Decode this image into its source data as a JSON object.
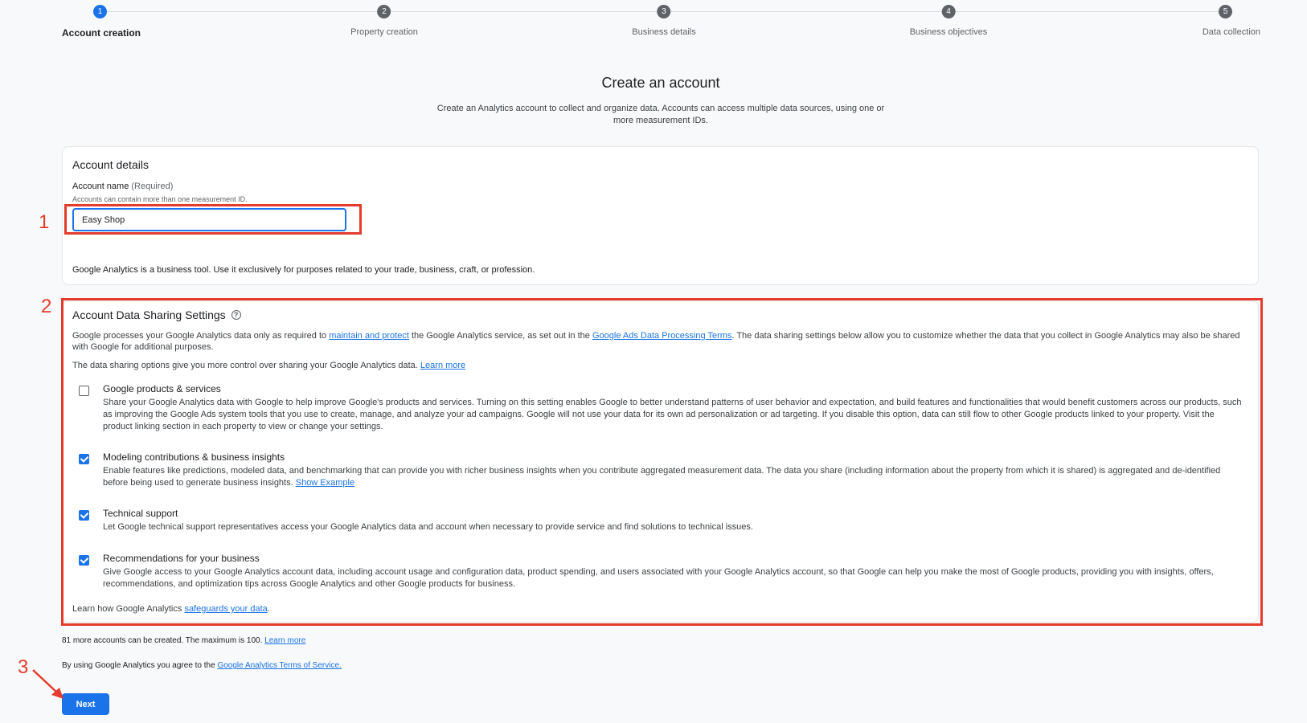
{
  "stepper": {
    "steps": [
      {
        "number": "1",
        "label": "Account creation",
        "active": true
      },
      {
        "number": "2",
        "label": "Property creation",
        "active": false
      },
      {
        "number": "3",
        "label": "Business details",
        "active": false
      },
      {
        "number": "4",
        "label": "Business objectives",
        "active": false
      },
      {
        "number": "5",
        "label": "Data collection",
        "active": false
      }
    ]
  },
  "header": {
    "title": "Create an account",
    "subtitle": "Create an Analytics account to collect and organize data. Accounts can access multiple data sources, using one or more measurement IDs."
  },
  "account_details": {
    "title": "Account details",
    "field_label": "Account name",
    "field_required": "(Required)",
    "field_hint": "Accounts can contain more than one measurement ID.",
    "field_value": "Easy Shop",
    "disclaimer": "Google Analytics is a business tool. Use it exclusively for purposes related to your trade, business, craft, or profession."
  },
  "sharing": {
    "title": "Account Data Sharing Settings",
    "help_icon": "?",
    "intro_1": "Google processes your Google Analytics data only as required to",
    "intro_link_1": "maintain and protect",
    "intro_2": "the Google Analytics service, as set out in the",
    "intro_link_2": "Google Ads Data Processing Terms",
    "intro_3": ". The data sharing settings below allow you to customize whether the data that you collect in Google Analytics may also be shared with Google for additional purposes.",
    "control_text": "The data sharing options give you more control over sharing your Google Analytics data.",
    "control_link": "Learn more",
    "options": [
      {
        "title": "Google products & services",
        "checked": false,
        "description": "Share your Google Analytics data with Google to help improve Google's products and services. Turning on this setting enables Google to better understand patterns of user behavior and expectation, and build features and functionalities that would benefit customers across our products, such as improving the Google Ads system tools that you use to create, manage, and analyze your ad campaigns. Google will not use your data for its own ad personalization or ad targeting. If you disable this option, data can still flow to other Google products linked to your property. Visit the product linking section in each property to view or change your settings."
      },
      {
        "title": "Modeling contributions & business insights",
        "checked": true,
        "description": "Enable features like predictions, modeled data, and benchmarking that can provide you with richer business insights when you contribute aggregated measurement data. The data you share (including information about the property from which it is shared) is aggregated and de-identified before being used to generate business insights.",
        "link": "Show Example"
      },
      {
        "title": "Technical support",
        "checked": true,
        "description": "Let Google technical support representatives access your Google Analytics data and account when necessary to provide service and find solutions to technical issues."
      },
      {
        "title": "Recommendations for your business",
        "checked": true,
        "description": "Give Google access to your Google Analytics account data, including account usage and configuration data, product spending, and users associated with your Google Analytics account, so that Google can help you make the most of Google products, providing you with insights, offers, recommendations, and optimization tips across Google Analytics and other Google products for business."
      }
    ],
    "safeguard_text": "Learn how Google Analytics",
    "safeguard_link": "safeguards your data",
    "safeguard_end": "."
  },
  "footer": {
    "accounts_text": "81 more accounts can be created. The maximum is 100.",
    "accounts_link": "Learn more",
    "terms_text": "By using Google Analytics you agree to the",
    "terms_link": "Google Analytics Terms of Service.",
    "next_label": "Next"
  },
  "annotations": {
    "label_1": "1",
    "label_2": "2",
    "label_3": "3",
    "color": "#e53b2c"
  }
}
